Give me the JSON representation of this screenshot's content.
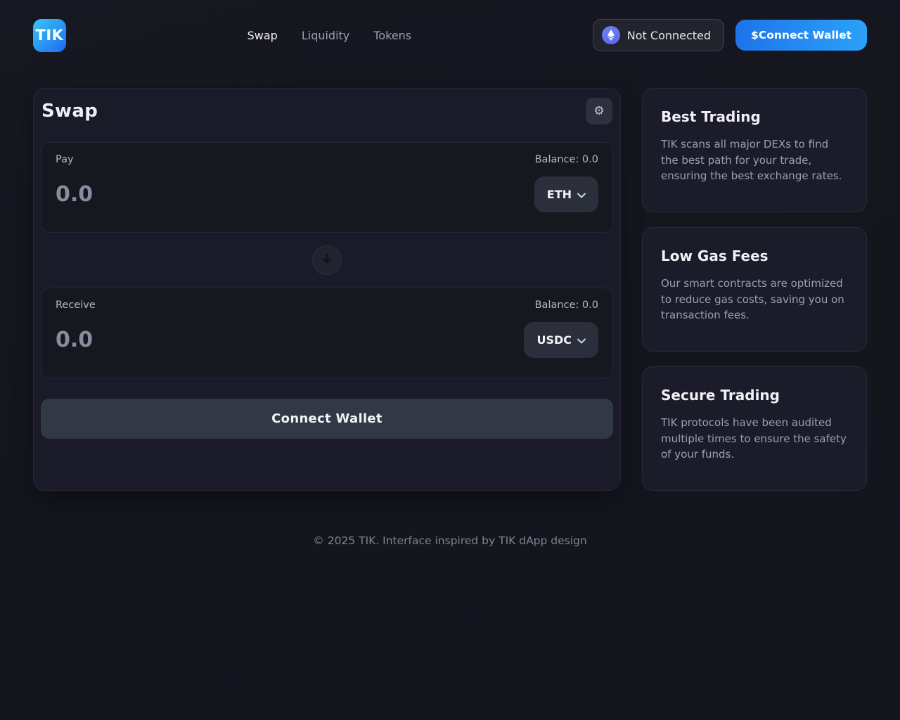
{
  "colors": {
    "accent-blue": "#1d73ea",
    "accent-blue-light": "#2ba2f8",
    "logo-cyan": "#38c6f4",
    "logo-blue": "#1d6bf0",
    "eth-icon-purple": "#5a68ef",
    "card-bg": "#1a1a28",
    "panel-bg": "#17171f",
    "button-gray": "#333846"
  },
  "header": {
    "logo_text": "TIK",
    "nav": [
      {
        "label": "Swap"
      },
      {
        "label": "Liquidity"
      },
      {
        "label": "Tokens"
      }
    ],
    "wallet_status": "Not Connected",
    "connect_wallet_label": "$Connect Wallet"
  },
  "swap": {
    "title": "Swap",
    "settings_icon": "⚙",
    "pay": {
      "label": "Pay",
      "balance": "Balance: 0.0",
      "amount_placeholder": "0.0",
      "token": "ETH"
    },
    "receive": {
      "label": "Receive",
      "balance": "Balance: 0.0",
      "amount_placeholder": "0.0",
      "token": "USDC"
    },
    "connect_button_label": "Connect Wallet"
  },
  "info_cards": [
    {
      "title": "Best Trading",
      "body": "TIK scans all major DEXs to find the best path for your trade, ensuring the best exchange rates."
    },
    {
      "title": "Low Gas Fees",
      "body": "Our smart contracts are optimized to reduce gas costs, saving you on transaction fees."
    },
    {
      "title": "Secure Trading",
      "body": "TIK protocols have been audited multiple times to ensure the safety of your funds."
    }
  ],
  "footer": {
    "copyright": "© 2025 TIK. Interface inspired by TIK dApp design"
  }
}
